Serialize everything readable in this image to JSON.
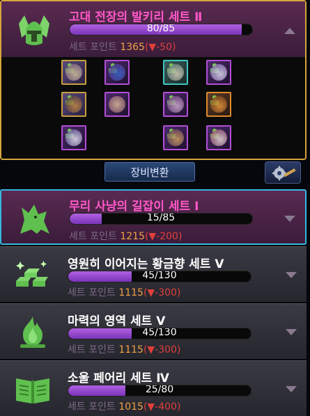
{
  "sets": [
    {
      "title": "고대 전장의 발키리 세트 Ⅱ",
      "progress": "80/85",
      "progress_fraction": 0.941,
      "points_label": "세트 포인트",
      "points_value": "1365",
      "points_diff": "(▼-50)",
      "icon": "helmet-icon",
      "expanded": true,
      "equip_label": "장비변환"
    },
    {
      "title": "무리 사냥의 길잡이 세트 Ⅰ",
      "progress": "15/85",
      "progress_fraction": 0.176,
      "points_label": "세트 포인트",
      "points_value": "1215",
      "points_diff": "(▼-200)",
      "icon": "wolf-icon"
    },
    {
      "title": "영원히 이어지는 황금향 세트 Ⅴ",
      "progress": "45/130",
      "progress_fraction": 0.346,
      "points_label": "세트 포인트",
      "points_value": "1115",
      "points_diff": "(▼-300)",
      "icon": "gold-bars-icon"
    },
    {
      "title": "마력의 영역 세트 Ⅴ",
      "progress": "45/130",
      "progress_fraction": 0.346,
      "points_label": "세트 포인트",
      "points_value": "1115",
      "points_diff": "(▼-300)",
      "icon": "flame-icon"
    },
    {
      "title": "소울 페어리 세트 Ⅳ",
      "progress": "25/80",
      "progress_fraction": 0.313,
      "points_label": "세트 포인트",
      "points_value": "1015",
      "points_diff": "(▼-400)",
      "icon": "book-icon"
    }
  ],
  "colors": {
    "title_pink": "#ff58c8",
    "title_white": "#ffffff",
    "points_value": "#f0a244",
    "points_diff": "#e0403a",
    "expanded_border": "#d6a53a",
    "selected_border": "#36b8e0"
  }
}
